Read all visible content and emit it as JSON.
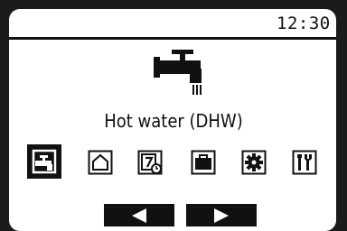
{
  "status": {
    "time": "12:30"
  },
  "main": {
    "title": "Hot water (DHW)",
    "icon": "tap-icon"
  },
  "menu": {
    "selected": "hot-water",
    "items": [
      {
        "id": "hot-water",
        "icon": "tap-icon"
      },
      {
        "id": "heating",
        "icon": "house-icon"
      },
      {
        "id": "schedule",
        "icon": "calendar-clock-icon"
      },
      {
        "id": "holiday",
        "icon": "suitcase-icon"
      },
      {
        "id": "settings",
        "icon": "gear-icon"
      },
      {
        "id": "service",
        "icon": "wrench-screwdriver-icon"
      }
    ]
  },
  "nav": {
    "left": "left-arrow-icon",
    "right": "right-arrow-icon"
  }
}
